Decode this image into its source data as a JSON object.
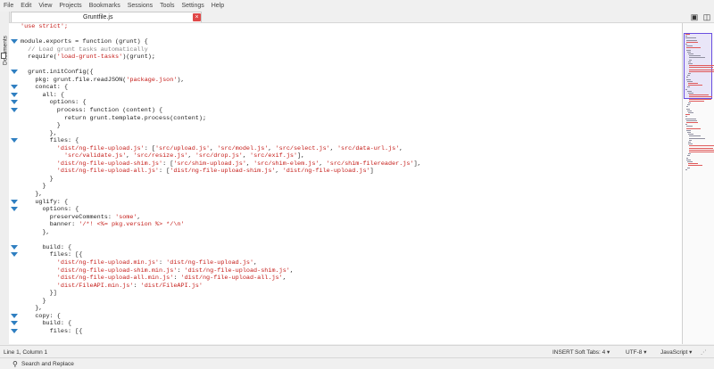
{
  "menu": [
    "File",
    "Edit",
    "View",
    "Projects",
    "Bookmarks",
    "Sessions",
    "Tools",
    "Settings",
    "Help"
  ],
  "tab": {
    "title": "Gruntfile.js",
    "close": "×"
  },
  "side": {
    "label": "Documents"
  },
  "code_lines": [
    {
      "fold": false,
      "parts": [
        {
          "t": "s",
          "v": "'use strict';"
        }
      ]
    },
    {
      "fold": false,
      "parts": []
    },
    {
      "fold": true,
      "parts": [
        {
          "t": "p",
          "v": "module.exports = function (grunt) {"
        }
      ]
    },
    {
      "fold": false,
      "parts": [
        {
          "t": "c",
          "v": "  // Load grunt tasks automatically"
        }
      ]
    },
    {
      "fold": false,
      "parts": [
        {
          "t": "p",
          "v": "  require("
        },
        {
          "t": "s",
          "v": "'load-grunt-tasks'"
        },
        {
          "t": "p",
          "v": ")(grunt);"
        }
      ]
    },
    {
      "fold": false,
      "parts": []
    },
    {
      "fold": true,
      "parts": [
        {
          "t": "p",
          "v": "  grunt.initConfig({"
        }
      ]
    },
    {
      "fold": false,
      "parts": [
        {
          "t": "p",
          "v": "    pkg: grunt.file.readJSON("
        },
        {
          "t": "s",
          "v": "'package.json'"
        },
        {
          "t": "p",
          "v": "),"
        }
      ]
    },
    {
      "fold": true,
      "parts": [
        {
          "t": "p",
          "v": "    concat: {"
        }
      ]
    },
    {
      "fold": true,
      "parts": [
        {
          "t": "p",
          "v": "      all: {"
        }
      ]
    },
    {
      "fold": true,
      "parts": [
        {
          "t": "p",
          "v": "        options: {"
        }
      ]
    },
    {
      "fold": true,
      "parts": [
        {
          "t": "p",
          "v": "          process: function (content) {"
        }
      ]
    },
    {
      "fold": false,
      "parts": [
        {
          "t": "p",
          "v": "            return grunt.template.process(content);"
        }
      ]
    },
    {
      "fold": false,
      "parts": [
        {
          "t": "p",
          "v": "          }"
        }
      ]
    },
    {
      "fold": false,
      "parts": [
        {
          "t": "p",
          "v": "        },"
        }
      ]
    },
    {
      "fold": true,
      "parts": [
        {
          "t": "p",
          "v": "        files: {"
        }
      ]
    },
    {
      "fold": false,
      "parts": [
        {
          "t": "s",
          "v": "          'dist/ng-file-upload.js'"
        },
        {
          "t": "p",
          "v": ": ["
        },
        {
          "t": "s",
          "v": "'src/upload.js'"
        },
        {
          "t": "p",
          "v": ", "
        },
        {
          "t": "s",
          "v": "'src/model.js'"
        },
        {
          "t": "p",
          "v": ", "
        },
        {
          "t": "s",
          "v": "'src/select.js'"
        },
        {
          "t": "p",
          "v": ", "
        },
        {
          "t": "s",
          "v": "'src/data-url.js'"
        },
        {
          "t": "p",
          "v": ","
        }
      ]
    },
    {
      "fold": false,
      "parts": [
        {
          "t": "s",
          "v": "            'src/validate.js'"
        },
        {
          "t": "p",
          "v": ", "
        },
        {
          "t": "s",
          "v": "'src/resize.js'"
        },
        {
          "t": "p",
          "v": ", "
        },
        {
          "t": "s",
          "v": "'src/drop.js'"
        },
        {
          "t": "p",
          "v": ", "
        },
        {
          "t": "s",
          "v": "'src/exif.js'"
        },
        {
          "t": "p",
          "v": "],"
        }
      ]
    },
    {
      "fold": false,
      "parts": [
        {
          "t": "s",
          "v": "          'dist/ng-file-upload-shim.js'"
        },
        {
          "t": "p",
          "v": ": ["
        },
        {
          "t": "s",
          "v": "'src/shim-upload.js'"
        },
        {
          "t": "p",
          "v": ", "
        },
        {
          "t": "s",
          "v": "'src/shim-elem.js'"
        },
        {
          "t": "p",
          "v": ", "
        },
        {
          "t": "s",
          "v": "'src/shim-filereader.js'"
        },
        {
          "t": "p",
          "v": "],"
        }
      ]
    },
    {
      "fold": false,
      "parts": [
        {
          "t": "s",
          "v": "          'dist/ng-file-upload-all.js'"
        },
        {
          "t": "p",
          "v": ": ["
        },
        {
          "t": "s",
          "v": "'dist/ng-file-upload-shim.js'"
        },
        {
          "t": "p",
          "v": ", "
        },
        {
          "t": "s",
          "v": "'dist/ng-file-upload.js'"
        },
        {
          "t": "p",
          "v": "]"
        }
      ]
    },
    {
      "fold": false,
      "parts": [
        {
          "t": "p",
          "v": "        }"
        }
      ]
    },
    {
      "fold": false,
      "parts": [
        {
          "t": "p",
          "v": "      }"
        }
      ]
    },
    {
      "fold": false,
      "parts": [
        {
          "t": "p",
          "v": "    },"
        }
      ]
    },
    {
      "fold": true,
      "parts": [
        {
          "t": "p",
          "v": "    uglify: {"
        }
      ]
    },
    {
      "fold": true,
      "parts": [
        {
          "t": "p",
          "v": "      options: {"
        }
      ]
    },
    {
      "fold": false,
      "parts": [
        {
          "t": "p",
          "v": "        preserveComments: "
        },
        {
          "t": "s",
          "v": "'some'"
        },
        {
          "t": "p",
          "v": ","
        }
      ]
    },
    {
      "fold": false,
      "parts": [
        {
          "t": "p",
          "v": "        banner: "
        },
        {
          "t": "s",
          "v": "'/*! <%= pkg.version %> */\\n'"
        }
      ]
    },
    {
      "fold": false,
      "parts": [
        {
          "t": "p",
          "v": "      },"
        }
      ]
    },
    {
      "fold": false,
      "parts": []
    },
    {
      "fold": true,
      "parts": [
        {
          "t": "p",
          "v": "      build: {"
        }
      ]
    },
    {
      "fold": true,
      "parts": [
        {
          "t": "p",
          "v": "        files: [{"
        }
      ]
    },
    {
      "fold": false,
      "parts": [
        {
          "t": "s",
          "v": "          'dist/ng-file-upload.min.js'"
        },
        {
          "t": "p",
          "v": ": "
        },
        {
          "t": "s",
          "v": "'dist/ng-file-upload.js'"
        },
        {
          "t": "p",
          "v": ","
        }
      ]
    },
    {
      "fold": false,
      "parts": [
        {
          "t": "s",
          "v": "          'dist/ng-file-upload-shim.min.js'"
        },
        {
          "t": "p",
          "v": ": "
        },
        {
          "t": "s",
          "v": "'dist/ng-file-upload-shim.js'"
        },
        {
          "t": "p",
          "v": ","
        }
      ]
    },
    {
      "fold": false,
      "parts": [
        {
          "t": "s",
          "v": "          'dist/ng-file-upload-all.min.js'"
        },
        {
          "t": "p",
          "v": ": "
        },
        {
          "t": "s",
          "v": "'dist/ng-file-upload-all.js'"
        },
        {
          "t": "p",
          "v": ","
        }
      ]
    },
    {
      "fold": false,
      "parts": [
        {
          "t": "s",
          "v": "          'dist/FileAPI.min.js'"
        },
        {
          "t": "p",
          "v": ": "
        },
        {
          "t": "s",
          "v": "'dist/FileAPI.js'"
        }
      ]
    },
    {
      "fold": false,
      "parts": [
        {
          "t": "p",
          "v": "        }]"
        }
      ]
    },
    {
      "fold": false,
      "parts": [
        {
          "t": "p",
          "v": "      }"
        }
      ]
    },
    {
      "fold": false,
      "parts": [
        {
          "t": "p",
          "v": "    },"
        }
      ]
    },
    {
      "fold": true,
      "parts": [
        {
          "t": "p",
          "v": "    copy: {"
        }
      ]
    },
    {
      "fold": true,
      "parts": [
        {
          "t": "p",
          "v": "      build: {"
        }
      ]
    },
    {
      "fold": true,
      "parts": [
        {
          "t": "p",
          "v": "        files: [{"
        }
      ]
    }
  ],
  "status": {
    "position": "Line 1, Column 1",
    "mode": "INSERT",
    "tabs": "Soft Tabs: 4",
    "encoding": "UTF-8",
    "language": "JavaScript"
  },
  "search": {
    "label": "Search and Replace"
  },
  "colors": {
    "string": "#c41a16",
    "comment": "#8a8a8a",
    "fold": "#2f7fc1",
    "close": "#e04848"
  }
}
